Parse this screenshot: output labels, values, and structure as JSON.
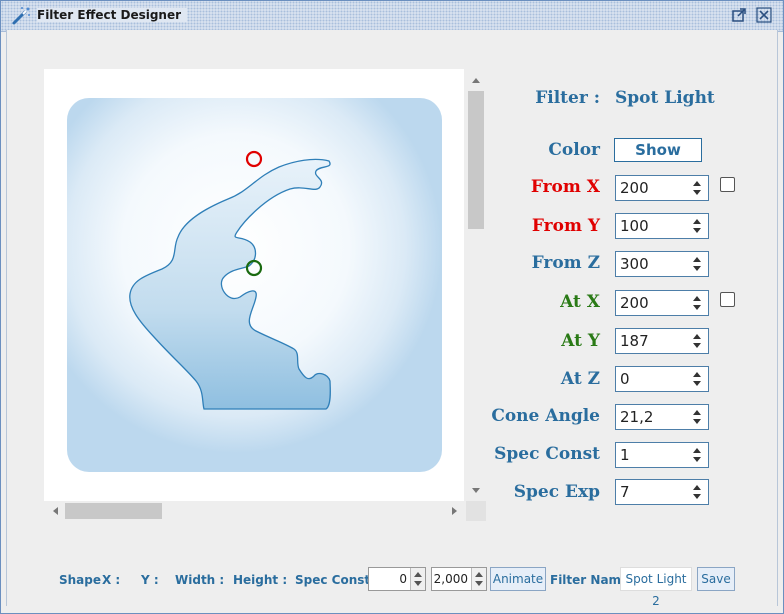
{
  "window": {
    "title": "Filter Effect Designer"
  },
  "filter": {
    "label": "Filter :",
    "value": "Spot Light"
  },
  "color": {
    "label": "Color",
    "button": "Show"
  },
  "fields": [
    {
      "label": "From X",
      "value": "200",
      "color": "red"
    },
    {
      "label": "From Y",
      "value": "100",
      "color": "red"
    },
    {
      "label": "From Z",
      "value": "300",
      "color": "blue"
    },
    {
      "label": "At X",
      "value": "200",
      "color": "green"
    },
    {
      "label": "At Y",
      "value": "187",
      "color": "green"
    },
    {
      "label": "At Z",
      "value": "0",
      "color": "blue"
    },
    {
      "label": "Cone Angle",
      "value": "21,2",
      "color": "blue"
    },
    {
      "label": "Spec Const",
      "value": "1",
      "color": "blue"
    },
    {
      "label": "Spec Exp",
      "value": "7",
      "color": "blue"
    }
  ],
  "bottom": {
    "shape_label": "Shape",
    "x_label": "X :",
    "y_label": "Y :",
    "width_label": "Width :",
    "height_label": "Height :",
    "spec_const_label": "Spec Const",
    "spin1_value": "0",
    "spin2_value": "2,000",
    "animate_button": "Animate",
    "filter_name_label": "Filter Name",
    "filter_name_value": "Spot Light 2",
    "save_button": "Save"
  },
  "colors": {
    "accent": "#2a6d9e",
    "from_marker": "#e00000",
    "at_marker": "#1a6a10"
  }
}
